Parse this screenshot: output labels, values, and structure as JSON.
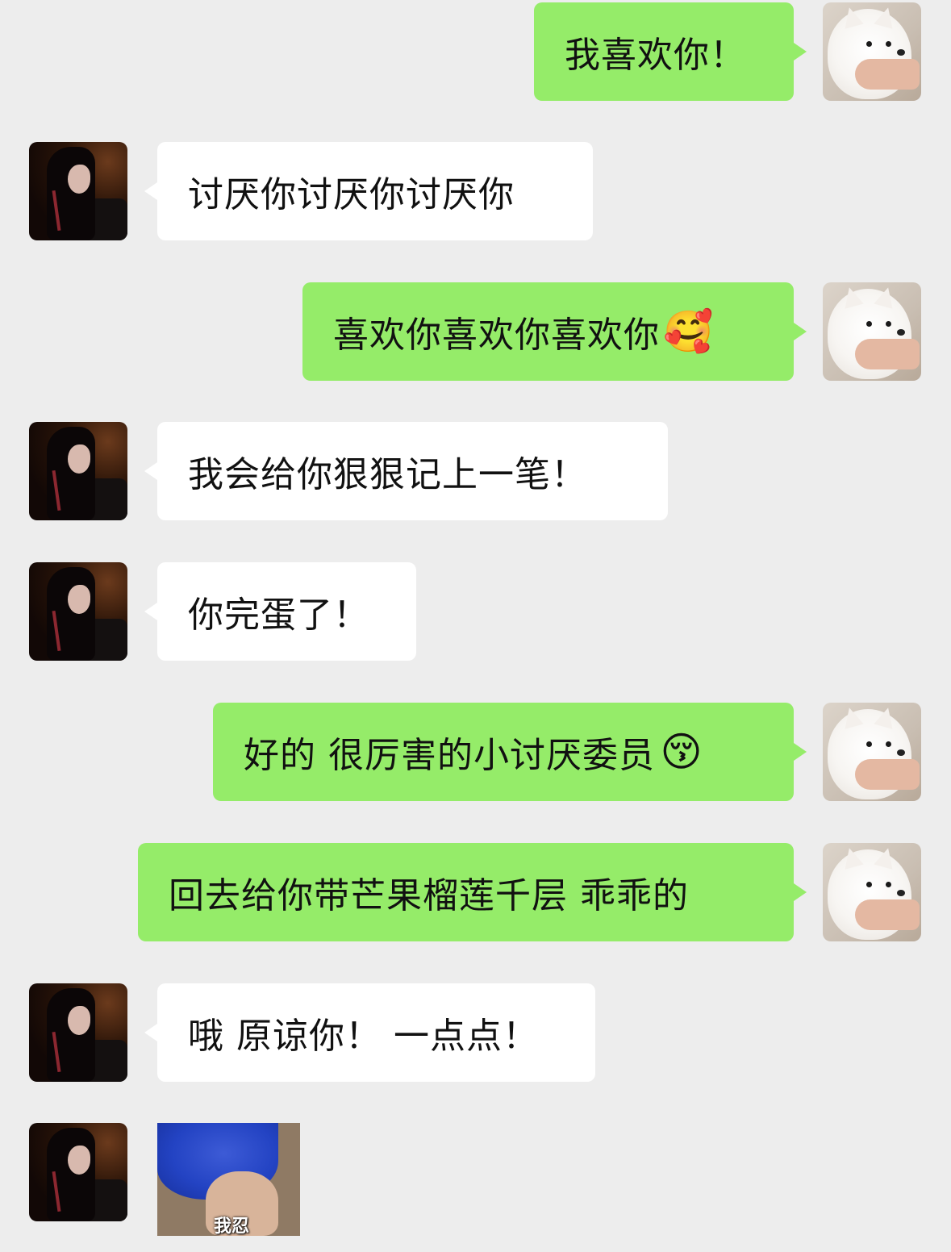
{
  "messages": [
    {
      "side": "out",
      "text": "我喜欢你！",
      "emoji": ""
    },
    {
      "side": "in",
      "text": "讨厌你讨厌你讨厌你",
      "emoji": ""
    },
    {
      "side": "out",
      "text": "喜欢你喜欢你喜欢你",
      "emoji": "🥰"
    },
    {
      "side": "in",
      "text": "我会给你狠狠记上一笔！",
      "emoji": ""
    },
    {
      "side": "in",
      "text": "你完蛋了！",
      "emoji": ""
    },
    {
      "side": "out",
      "text": "好的 很厉害的小讨厌委员",
      "emoji": "😚"
    },
    {
      "side": "out",
      "text": "回去给你带芒果榴莲千层 乖乖的",
      "emoji": ""
    },
    {
      "side": "in",
      "text": "哦 原谅你！ 一点点！",
      "emoji": ""
    }
  ],
  "sticker": {
    "caption": "我忍"
  }
}
